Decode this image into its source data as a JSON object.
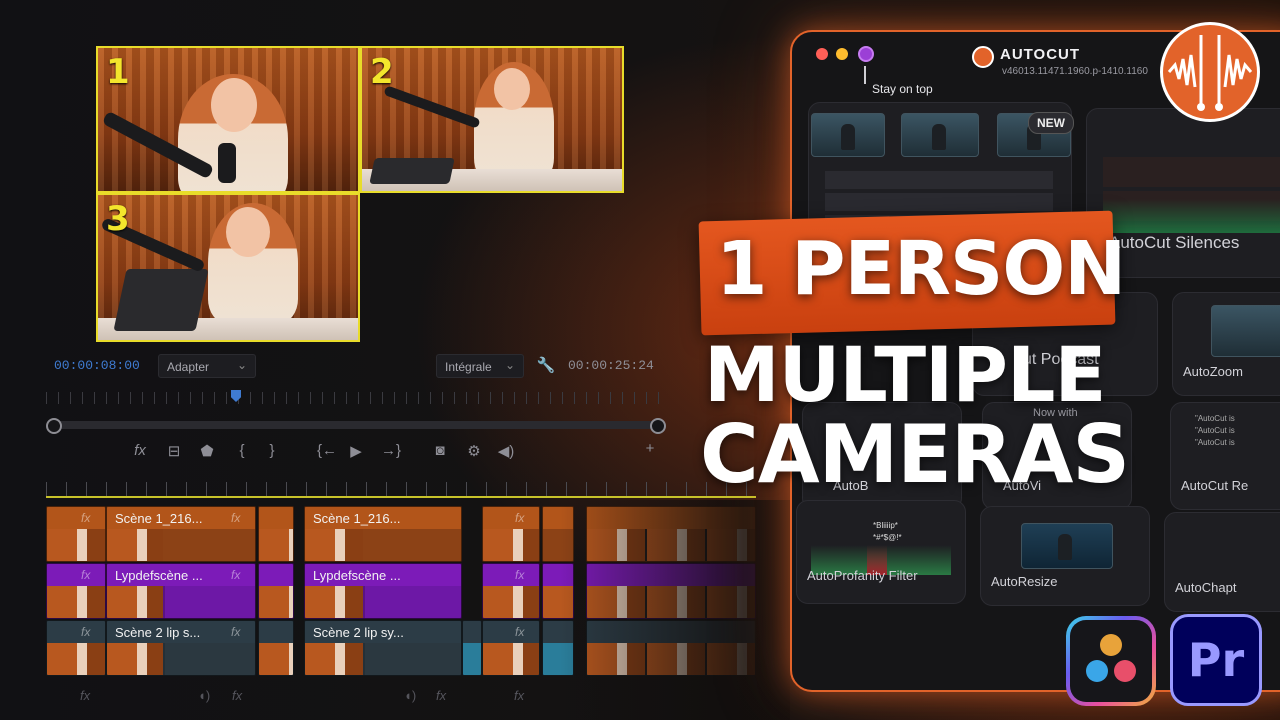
{
  "preview": {
    "cams": [
      {
        "num": "1"
      },
      {
        "num": "2"
      },
      {
        "num": "3"
      }
    ],
    "timecode_in": "00:00:08:00",
    "fit_select": "Adapter",
    "quality_select": "Intégrale",
    "timecode_total": "00:00:25:24"
  },
  "controls": {
    "fx_icon": "fx",
    "brace_open": "{",
    "brace_close": "}",
    "go_in": "{←",
    "play": "▶",
    "go_out": "→}",
    "add": "+"
  },
  "timeline": {
    "fx": "fx",
    "v1_clip_a": "Scène 1_216...",
    "v1_clip_b": "Scène 1_216...",
    "v2_clip_a": "Lypdefscène ...",
    "v2_clip_b": "Lypdefscène ...",
    "v3_clip_a": "Scène 2 lip s...",
    "v3_clip_b": "Scène 2 lip sy..."
  },
  "panel": {
    "app_name": "AUTOCUT",
    "version": "v46013.11471.1960.p-1410.1160",
    "stay_on_top": "Stay on top",
    "new_badge": "NEW",
    "cards": {
      "silences": "AutoCut Silences",
      "podcast": "ut Podcast",
      "zoom": "AutoZoom",
      "broll": "AutoB",
      "viral": "AutoVi",
      "repeat": "AutoCut Re",
      "profanity": "AutoProfanity Filter",
      "resize": "AutoResize",
      "chapters": "AutoChapt",
      "now_with": "Now with",
      "bleep1": "*Bliiiip*",
      "bleep2": "*#*$@!*",
      "repeat_line1": "\"AutoCut is",
      "repeat_line2": "\"AutoCut is",
      "repeat_line3": "\"AutoCut is"
    }
  },
  "headline": {
    "line1": "1 PERSON",
    "line2": "MULTIPLE",
    "line3": "CAMERAS"
  },
  "logos": {
    "premiere": "Pr"
  },
  "colors": {
    "accent_orange": "#e2632a",
    "cam_border": "#e8dc2a",
    "track_orange": "#b2551a",
    "track_purple": "#7c1bb8",
    "track_teal": "#2c3c46",
    "timecode_blue": "#3f7bd1"
  }
}
